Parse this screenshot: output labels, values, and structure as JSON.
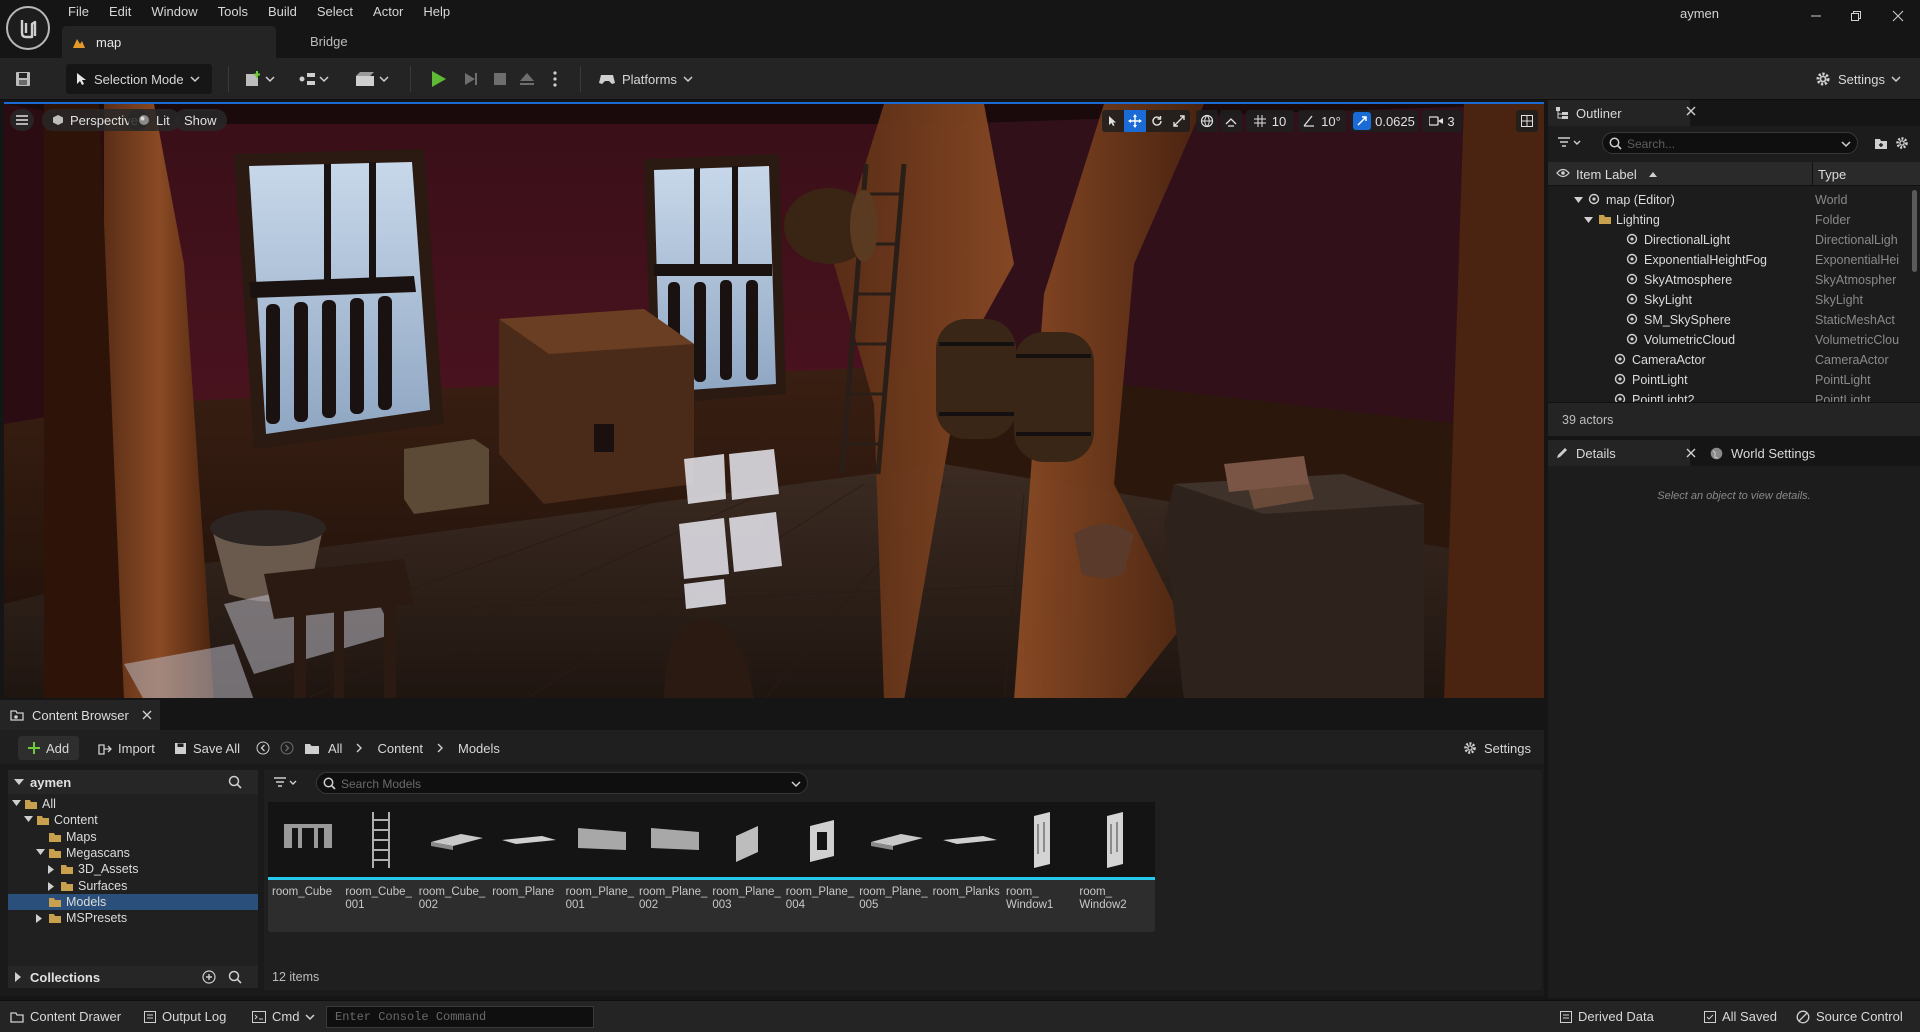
{
  "colors": {
    "accent": "#1a6bd6",
    "play": "#5fb836",
    "asset_underline": "#27c9ee",
    "folder": "#c8a04e"
  },
  "menu": [
    "File",
    "Edit",
    "Window",
    "Tools",
    "Build",
    "Select",
    "Actor",
    "Help"
  ],
  "tabs": {
    "map": "map",
    "bridge": "Bridge"
  },
  "user": "aymen",
  "toolbar": {
    "selection_mode": "Selection Mode",
    "platforms": "Platforms",
    "settings": "Settings"
  },
  "viewport": {
    "perspective": "Perspective",
    "lit": "Lit",
    "show": "Show",
    "grid_snap": "10",
    "rotation_snap": "10°",
    "scale_snap": "0.0625",
    "camera_speed": "3"
  },
  "outliner": {
    "title": "Outliner",
    "search_placeholder": "Search...",
    "col_label": "Item Label",
    "col_type": "Type",
    "rows": [
      {
        "label": "map (Editor)",
        "type": "World"
      },
      {
        "label": "Lighting",
        "type": "Folder"
      },
      {
        "label": "DirectionalLight",
        "type": "DirectionalLigh"
      },
      {
        "label": "ExponentialHeightFog",
        "type": "ExponentialHei"
      },
      {
        "label": "SkyAtmosphere",
        "type": "SkyAtmospher"
      },
      {
        "label": "SkyLight",
        "type": "SkyLight"
      },
      {
        "label": "SM_SkySphere",
        "type": "StaticMeshAct"
      },
      {
        "label": "VolumetricCloud",
        "type": "VolumetricClou"
      },
      {
        "label": "CameraActor",
        "type": "CameraActor"
      },
      {
        "label": "PointLight",
        "type": "PointLight"
      },
      {
        "label": "PointLight2",
        "type": "PointLight"
      }
    ],
    "count": "39 actors"
  },
  "details": {
    "title": "Details",
    "world_settings": "World Settings",
    "empty": "Select an object to view details."
  },
  "content_browser": {
    "title": "Content Browser",
    "add": "Add",
    "import": "Import",
    "save_all": "Save All",
    "breadcrumb": [
      "All",
      "Content",
      "Models"
    ],
    "settings": "Settings",
    "source_root": "aymen",
    "tree": [
      {
        "label": "All",
        "depth": 0
      },
      {
        "label": "Content",
        "depth": 1
      },
      {
        "label": "Maps",
        "depth": 2
      },
      {
        "label": "Megascans",
        "depth": 2
      },
      {
        "label": "3D_Assets",
        "depth": 3
      },
      {
        "label": "Surfaces",
        "depth": 3
      },
      {
        "label": "Models",
        "depth": 2,
        "selected": true
      },
      {
        "label": "MSPresets",
        "depth": 2
      }
    ],
    "collections": "Collections",
    "search_placeholder": "Search Models",
    "assets": [
      {
        "name": "room_Cube",
        "icon": "arch-icon"
      },
      {
        "name": "room_Cube_ 001",
        "icon": "ladder-icon"
      },
      {
        "name": "room_Cube_ 002",
        "icon": "slab-icon"
      },
      {
        "name": "room_Plane",
        "icon": "plane-icon"
      },
      {
        "name": "room_Plane_ 001",
        "icon": "wall-icon"
      },
      {
        "name": "room_Plane_ 002",
        "icon": "wall-icon"
      },
      {
        "name": "room_Plane_ 003",
        "icon": "panel-icon"
      },
      {
        "name": "room_Plane_ 004",
        "icon": "window-frame-icon"
      },
      {
        "name": "room_Plane_ 005",
        "icon": "slab-icon"
      },
      {
        "name": "room_Planks",
        "icon": "plane-icon"
      },
      {
        "name": "room_ Window1",
        "icon": "pillar-icon"
      },
      {
        "name": "room_ Window2",
        "icon": "pillar-icon"
      }
    ],
    "item_count": "12 items"
  },
  "statusbar": {
    "content_drawer": "Content Drawer",
    "output_log": "Output Log",
    "cmd": "Cmd",
    "console_placeholder": "Enter Console Command",
    "derived_data": "Derived Data",
    "all_saved": "All Saved",
    "source_control": "Source Control"
  }
}
